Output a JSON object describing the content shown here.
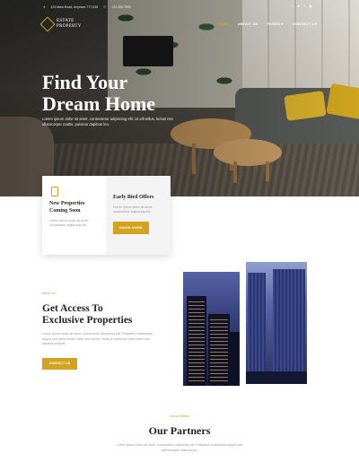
{
  "topbar": {
    "address": "123 Main Road, Anytown 777,045",
    "phone": "123-456-7890",
    "social_icons": [
      "facebook-icon",
      "pinterest-icon",
      "twitter-icon",
      "youtube-icon"
    ]
  },
  "logo": {
    "line1": "ESTATE",
    "line2": "PROPERTY"
  },
  "nav": {
    "items": [
      {
        "label": "HOME",
        "active": true
      },
      {
        "label": "ABOUT US"
      },
      {
        "label": "PAGES",
        "has_dropdown": true,
        "chevron": "▾"
      },
      {
        "label": "CONTACT US"
      }
    ]
  },
  "hero": {
    "title_line1": "Find Your",
    "title_line2": "Dream Home",
    "subtitle": "Lorem ipsum dolor sit amet, consectetur adipiscing elit. Ut elit tellus, luctus nec ullamcorper mattis, pulvinar dapibus leo."
  },
  "cards": {
    "card1": {
      "title_line1": "New Properties",
      "title_line2": "Coming Soon",
      "text": "Lorem ipsum dolor sit amet, consectetur adipiscing elit."
    },
    "card2": {
      "title": "Early Bird Offers",
      "text": "Lorem ipsum dolor sit amet, consectetur adipiscing elit.",
      "button": "KNOW MORE"
    }
  },
  "about": {
    "kicker": "About Us",
    "title_line1": "Get Access To",
    "title_line2": "Exclusive Properties",
    "text": "Lorem ipsum dolor sit amet, consectetur adipiscing elit. Phasellus malesuada augue sed tellus ornare vitae nisi mauris. Nulla et commodo diam diam sed dapibus tempus.",
    "button": "CONTACT US"
  },
  "partners": {
    "kicker": "Global Partner",
    "title": "Our Partners",
    "text": "Lorem ipsum dolor sit amet, consectetur adipiscing elit. Phasellus malesuada augue sed pellentesque ullamcorper."
  },
  "colors": {
    "accent": "#d4a21f",
    "text_dark": "#222222",
    "text_muted": "#999999"
  }
}
